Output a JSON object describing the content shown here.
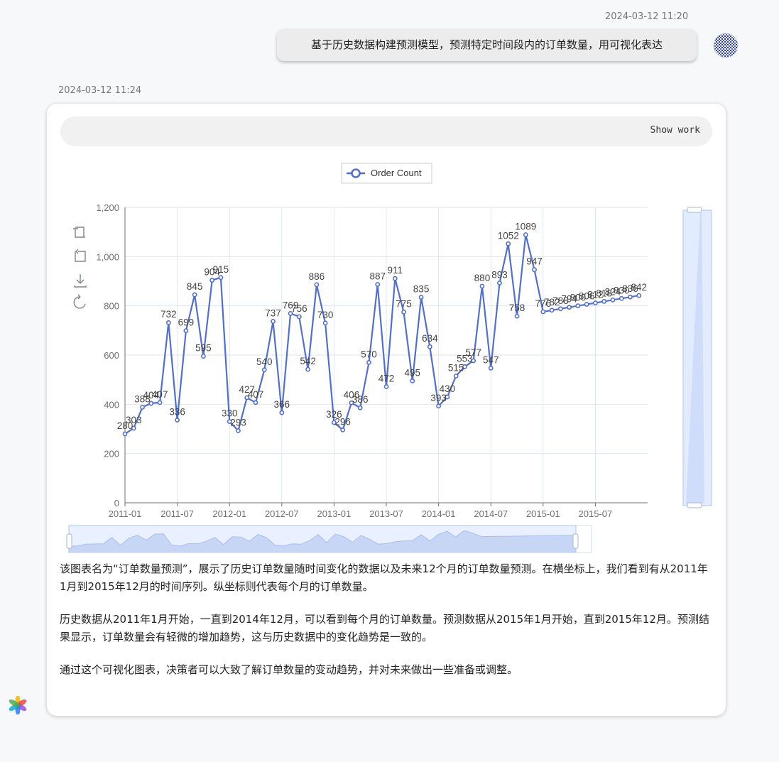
{
  "conversation": {
    "user_timestamp": "2024-03-12 11:20",
    "user_message": "基于历史数据构建预测模型，预测特定时间段内的订单数量，用可视化表达",
    "bot_timestamp": "2024-03-12 11:24",
    "show_work_label": "Show work"
  },
  "toolbox": [
    "zoom-icon",
    "zoom-reset-icon",
    "download-icon",
    "restore-icon"
  ],
  "description": [
    "该图表名为“订单数量预测”，展示了历史订单数量随时间变化的数据以及未来12个月的订单数量预测。在横坐标上，我们看到有从2011年1月到2015年12月的时间序列。纵坐标则代表每个月的订单数量。",
    "历史数据从2011年1月开始，一直到2014年12月，可以看到每个月的订单数量。预测数据从2015年1月开始，直到2015年12月。预测结果显示，订单数量会有轻微的增加趋势，这与历史数据中的变化趋势是一致的。",
    "通过这个可视化图表，决策者可以大致了解订单数量的变动趋势，并对未来做出一些准备或调整。"
  ],
  "colors": {
    "series": "#5470c6",
    "grid": "#e0e6f1",
    "axis": "#6e7079",
    "zoom_fill": "#dbe6ff"
  },
  "chart_data": {
    "type": "line",
    "x": [
      "2011-01",
      "2011-02",
      "2011-03",
      "2011-04",
      "2011-05",
      "2011-06",
      "2011-07",
      "2011-08",
      "2011-09",
      "2011-10",
      "2011-11",
      "2011-12",
      "2012-01",
      "2012-02",
      "2012-03",
      "2012-04",
      "2012-05",
      "2012-06",
      "2012-07",
      "2012-08",
      "2012-09",
      "2012-10",
      "2012-11",
      "2012-12",
      "2013-01",
      "2013-02",
      "2013-03",
      "2013-04",
      "2013-05",
      "2013-06",
      "2013-07",
      "2013-08",
      "2013-09",
      "2013-10",
      "2013-11",
      "2013-12",
      "2014-01",
      "2014-02",
      "2014-03",
      "2014-04",
      "2014-05",
      "2014-06",
      "2014-07",
      "2014-08",
      "2014-09",
      "2014-10",
      "2014-11",
      "2014-12",
      "2015-01",
      "2015-02",
      "2015-03",
      "2015-04",
      "2015-05",
      "2015-06",
      "2015-07",
      "2015-08",
      "2015-09",
      "2015-10",
      "2015-11",
      "2015-12"
    ],
    "series": [
      {
        "name": "Order Count",
        "values": [
          280,
          303,
          388,
          404,
          407,
          732,
          336,
          699,
          845,
          595,
          904,
          915,
          330,
          293,
          427,
          407,
          540,
          737,
          366,
          769,
          756,
          542,
          886,
          730,
          326,
          296,
          406,
          386,
          570,
          887,
          472,
          911,
          775,
          495,
          835,
          634,
          393,
          430,
          515,
          553,
          577,
          880,
          547,
          893,
          1052,
          758,
          1089,
          947,
          776,
          782,
          788,
          794,
          800,
          806,
          812,
          818,
          824,
          830,
          836,
          842
        ]
      }
    ],
    "point_labels": [
      "280",
      "303",
      "388",
      "404",
      "407",
      "732",
      "336",
      "699",
      "845",
      "595",
      "904",
      "915",
      "330",
      "293",
      "427",
      "407",
      "540",
      "737",
      "366",
      "769",
      "756",
      "542",
      "886",
      "730",
      "326",
      "296",
      "406",
      "386",
      "570",
      "887",
      "472",
      "911",
      "775",
      "495",
      "835",
      "634",
      "393",
      "430",
      "515",
      "553",
      "577",
      "880",
      "547",
      "893",
      "1052",
      "758",
      "1089",
      "947",
      "776",
      "782",
      "788",
      "794",
      "800",
      "806",
      "812",
      "818",
      "824",
      "830",
      "836",
      "842"
    ],
    "x_ticks": [
      "2011-01",
      "2011-07",
      "2012-01",
      "2012-07",
      "2013-01",
      "2013-07",
      "2014-01",
      "2014-07",
      "2015-01",
      "2015-07"
    ],
    "y_ticks": [
      "0",
      "200",
      "400",
      "600",
      "800",
      "1,000",
      "1,200"
    ],
    "ylim": [
      0,
      1200
    ],
    "grid": true,
    "legend_position": "top-center",
    "data_zoom": [
      "bottom-slider",
      "right-slider"
    ]
  }
}
